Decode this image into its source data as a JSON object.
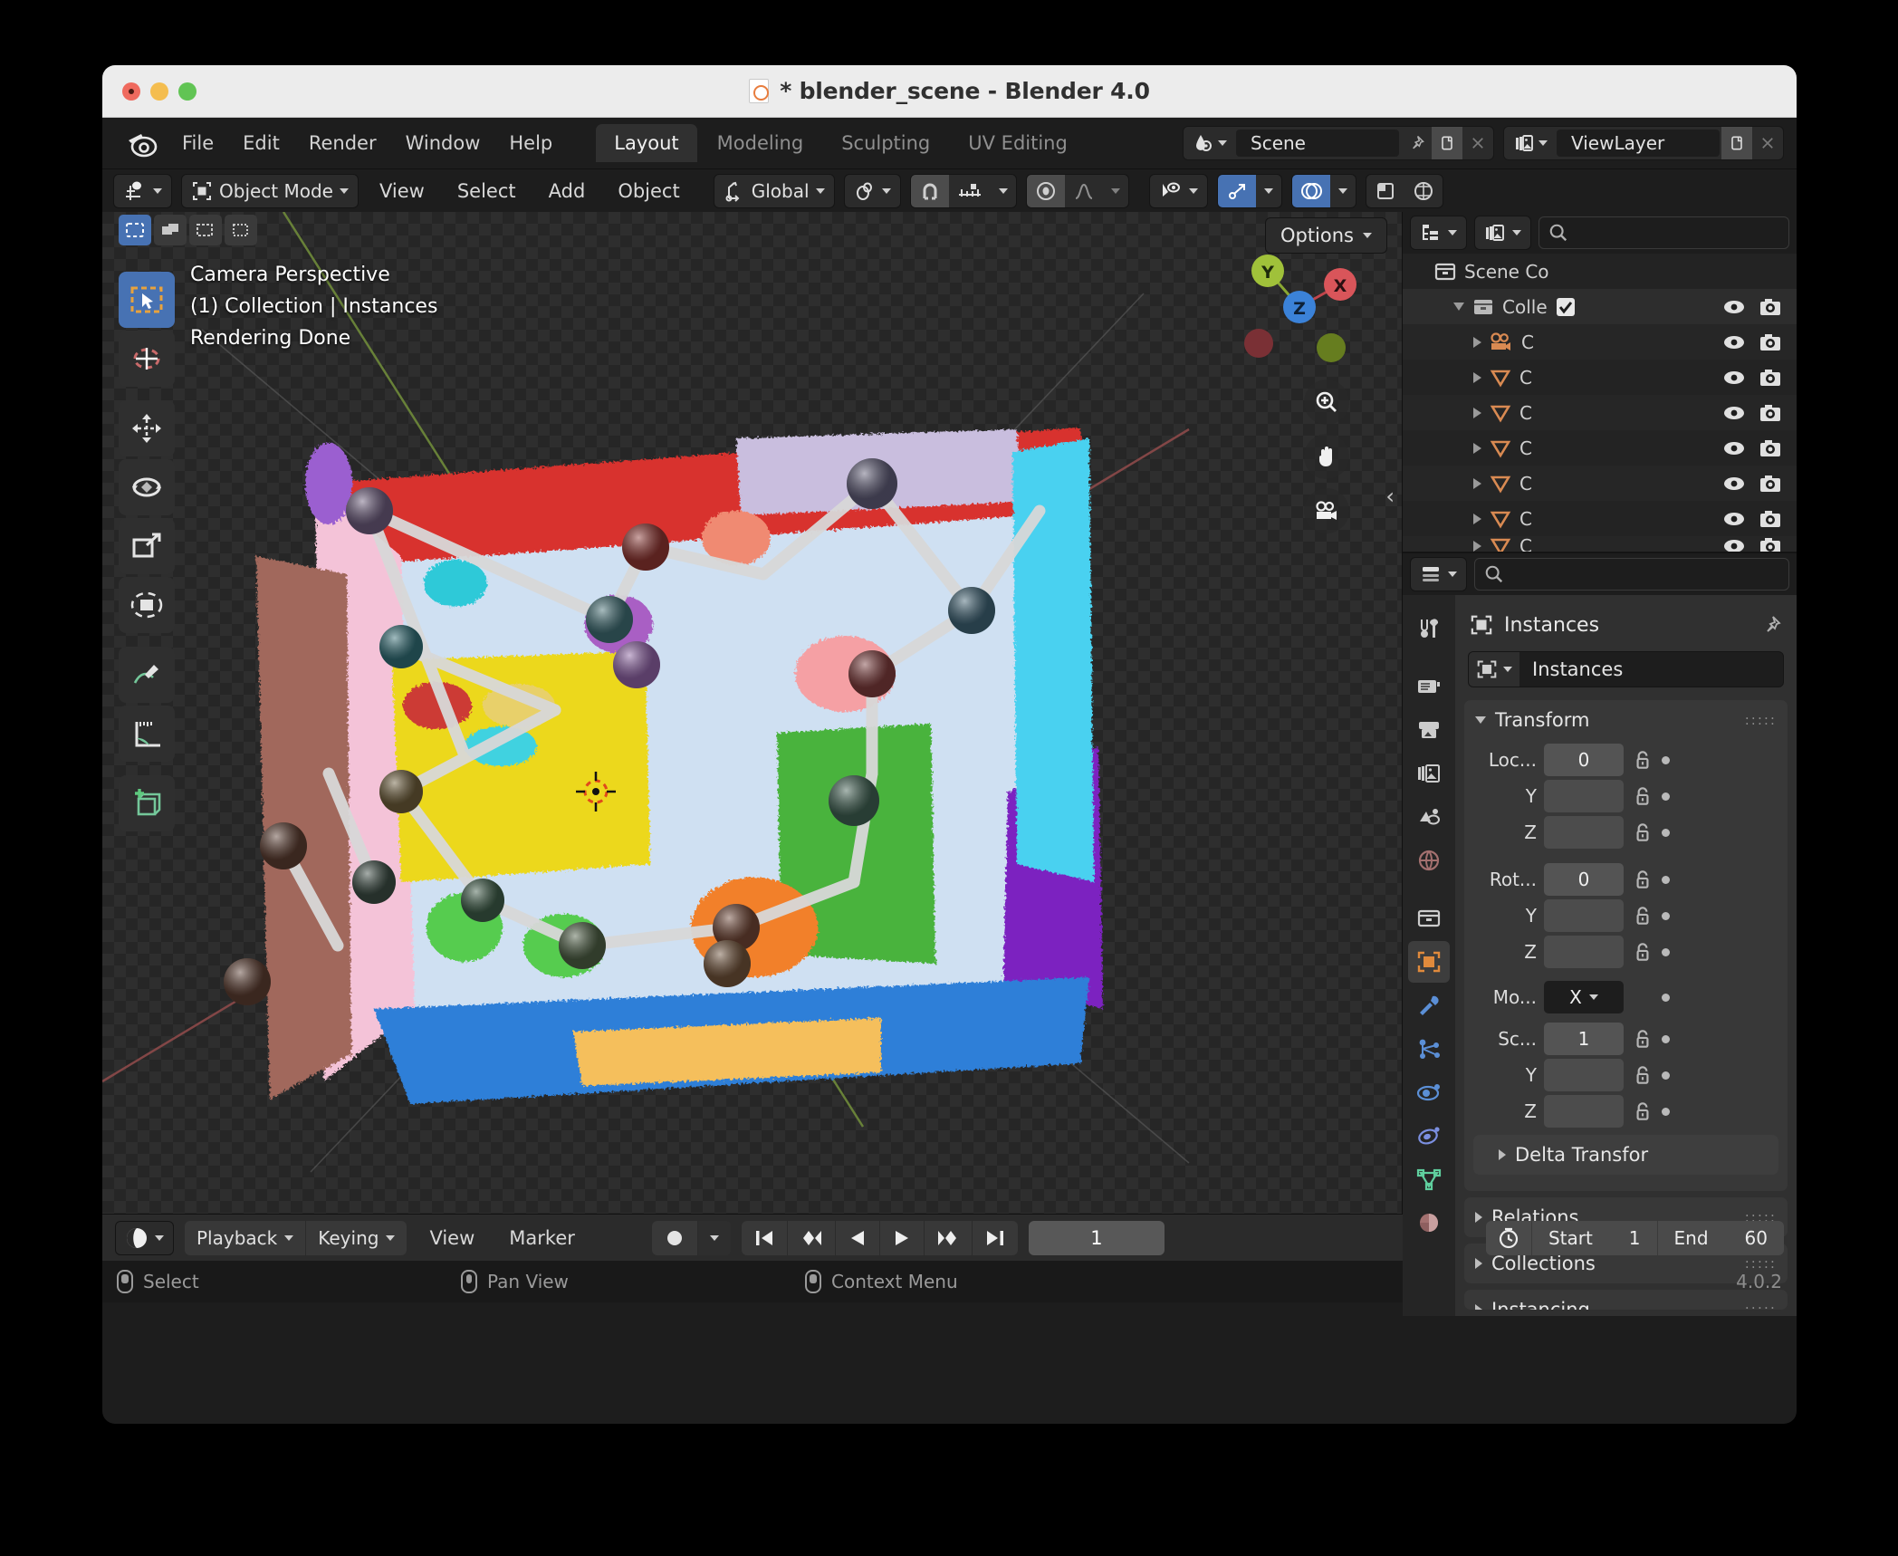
{
  "window": {
    "title": "* blender_scene - Blender 4.0",
    "title_icon": "blender-file-icon",
    "traffic_lights": [
      "close",
      "minimize",
      "maximize"
    ]
  },
  "topbar": {
    "logo": "blender-logo-icon",
    "menus": [
      "File",
      "Edit",
      "Render",
      "Window",
      "Help"
    ],
    "workspace_tabs": [
      {
        "label": "Layout",
        "active": true
      },
      {
        "label": "Modeling",
        "active": false
      },
      {
        "label": "Sculpting",
        "active": false
      },
      {
        "label": "UV Editing",
        "active": false
      }
    ],
    "scene": {
      "icon": "scene-icon",
      "name": "Scene",
      "pin": "pin-icon",
      "copy": "duplicate-icon",
      "remove": "x-icon"
    },
    "viewlayer": {
      "icon": "viewlayer-icon",
      "name": "ViewLayer",
      "copy": "duplicate-icon",
      "remove": "x-icon"
    }
  },
  "viewport_header": {
    "editor_type_icon": "editor-type-3dview-icon",
    "mode": "Object Mode",
    "mode_icon": "object-mode-icon",
    "menus": [
      "View",
      "Select",
      "Add",
      "Object"
    ],
    "transform_orientation": {
      "icon": "orientation-icon",
      "value": "Global"
    },
    "pivot_icon": "pivot-point-icon",
    "snap_magnet_icon": "magnet-icon",
    "snap_target_icon": "snap-increment-icon",
    "proportional_icon": "proportional-edit-icon",
    "falloff_icon": "falloff-curve-icon",
    "visibility_icon": "object-visibility-icon",
    "gizmo_icon": "gizmo-icon",
    "overlays_icon": "overlays-icon",
    "xray_icon": "xray-icon",
    "shading_icon": "shading-rendered-icon"
  },
  "viewport": {
    "overlay_lines": [
      "Camera Perspective",
      "(1) Collection | Instances",
      "Rendering Done"
    ],
    "options_label": "Options",
    "select_modes": [
      "tweak-select-icon",
      "box-select-icon",
      "circle-select-icon",
      "lasso-select-icon"
    ],
    "toolbar_tools": [
      "select-box-tool",
      "cursor-tool",
      "move-tool",
      "rotate-tool",
      "scale-tool",
      "transform-tool",
      "annotate-tool",
      "measure-tool",
      "add-cube-tool"
    ],
    "active_tool": "select-box-tool",
    "gizmo_axes": [
      {
        "label": "X",
        "color": "#d9555a"
      },
      {
        "label": "Y",
        "color": "#a0c13a"
      },
      {
        "label": "Z",
        "color": "#3b82d8"
      }
    ],
    "nav_buttons": [
      "zoom-icon",
      "pan-hand-icon",
      "camera-view-icon"
    ],
    "sidebar_toggle": "chevron-left-icon"
  },
  "outliner": {
    "display_mode_icon": "outliner-display-mode-icon",
    "filter_icon": "outliner-filter-icon",
    "search_placeholder": "",
    "search_icon": "search-icon",
    "rows": [
      {
        "indent": 0,
        "disclosure": "none",
        "icon": "scene-collection-icon",
        "label": "Scene Co",
        "checkbox": false,
        "eye": false,
        "camera": false
      },
      {
        "indent": 1,
        "disclosure": "open",
        "icon": "collection-icon",
        "label": "Colle",
        "checkbox": true,
        "eye": true,
        "camera": true
      },
      {
        "indent": 2,
        "disclosure": "closed",
        "icon": "camera-object-icon",
        "label": "C",
        "checkbox": false,
        "eye": true,
        "camera": true
      },
      {
        "indent": 2,
        "disclosure": "closed",
        "icon": "mesh-object-icon",
        "label": "C",
        "checkbox": false,
        "eye": true,
        "camera": true
      },
      {
        "indent": 2,
        "disclosure": "closed",
        "icon": "mesh-object-icon",
        "label": "C",
        "checkbox": false,
        "eye": true,
        "camera": true
      },
      {
        "indent": 2,
        "disclosure": "closed",
        "icon": "mesh-object-icon",
        "label": "C",
        "checkbox": false,
        "eye": true,
        "camera": true
      },
      {
        "indent": 2,
        "disclosure": "closed",
        "icon": "mesh-object-icon",
        "label": "C",
        "checkbox": false,
        "eye": true,
        "camera": true
      },
      {
        "indent": 2,
        "disclosure": "closed",
        "icon": "mesh-object-icon",
        "label": "C",
        "checkbox": false,
        "eye": true,
        "camera": true
      },
      {
        "indent": 2,
        "disclosure": "closed",
        "icon": "mesh-object-icon",
        "label": "C",
        "checkbox": false,
        "eye": true,
        "camera": true
      }
    ]
  },
  "properties": {
    "editor_icon": "properties-editor-icon",
    "search_icon": "search-icon",
    "breadcrumb": {
      "icon": "object-props-icon",
      "label": "Instances",
      "pin": "pin-icon"
    },
    "id_block": {
      "icon": "object-props-icon",
      "name": "Instances"
    },
    "tabs": [
      "tool-icon",
      "render-icon",
      "output-icon",
      "viewlayer-props-icon",
      "scene-props-icon",
      "world-props-icon",
      "collection-props-icon",
      "object-props-icon",
      "modifier-props-icon",
      "particles-props-icon",
      "physics-props-icon",
      "constraints-props-icon",
      "data-props-icon",
      "material-props-icon"
    ],
    "active_tab": "object-props-icon",
    "transform_panel": {
      "title": "Transform",
      "location": {
        "label": "Loc...",
        "x": "0",
        "y": "",
        "z": ""
      },
      "rotation": {
        "label": "Rot...",
        "x": "0",
        "y": "",
        "z": ""
      },
      "mode": {
        "label": "Mo...",
        "value": "X"
      },
      "scale": {
        "label": "Sc...",
        "x": "1",
        "y": "",
        "z": ""
      },
      "axis_labels": [
        "Y",
        "Z"
      ]
    },
    "collapsed_panels": [
      "Delta Transfor",
      "Relations",
      "Collections",
      "Instancing"
    ]
  },
  "timeline": {
    "editor_icon": "timeline-editor-icon",
    "menus": [
      "Playback",
      "Keying",
      "View",
      "Marker"
    ],
    "record_icon": "record-icon",
    "playback_buttons": [
      "jump-start-icon",
      "prev-keyframe-icon",
      "play-reverse-icon",
      "play-icon",
      "next-keyframe-icon",
      "jump-end-icon"
    ],
    "current_frame": "1",
    "clock_icon": "clock-icon",
    "start_label": "Start",
    "start_value": "1",
    "end_label": "End",
    "end_value": "60"
  },
  "statusbar": {
    "items": [
      {
        "icon": "mouse-left-icon",
        "label": "Select"
      },
      {
        "icon": "mouse-middle-icon",
        "label": "Pan View"
      },
      {
        "icon": "mouse-right-icon",
        "label": "Context Menu"
      }
    ],
    "version": "4.0.2"
  },
  "colors": {
    "accent_blue": "#4772b3",
    "axis_x": "#d9555a",
    "axis_y": "#a0c13a",
    "axis_z": "#3b82d8",
    "orange": "#e08a3c"
  }
}
